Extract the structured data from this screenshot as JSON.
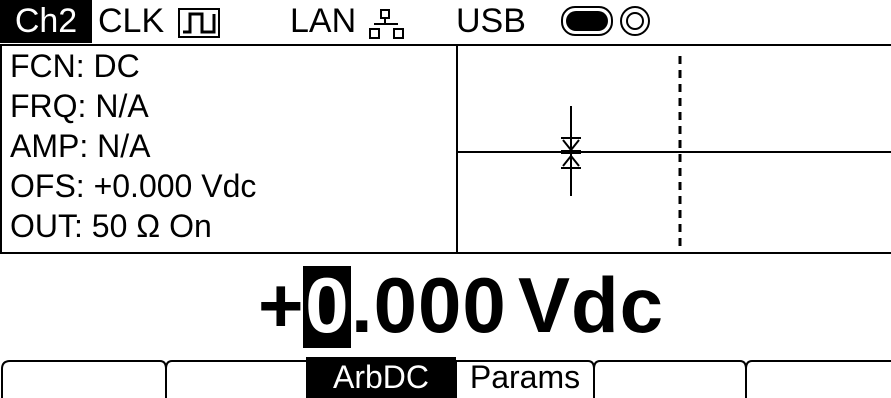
{
  "status_bar": {
    "channel": "Ch2",
    "clock_label": "CLK",
    "lan_label": "LAN",
    "usb_label": "USB"
  },
  "info_panel": {
    "function": "FCN: DC",
    "frequency": "FRQ: N/A",
    "amplitude": "AMP: N/A",
    "offset": "OFS: +0.000 Vdc",
    "output": "OUT: 50 Ω On"
  },
  "main_value": {
    "sign": "+",
    "cursor_digit": "0",
    "rest": ".000",
    "unit": "Vdc"
  },
  "softkeys": {
    "key1": "",
    "key2": "",
    "key3": "ArbDC",
    "key4": "Params",
    "key5": "",
    "key6": ""
  },
  "icons": {
    "clock": "square-wave-icon",
    "lan": "network-nodes-icon",
    "usb": "usb-drive-icon",
    "remote": "ring-icon"
  },
  "colors": {
    "foreground": "#000000",
    "background": "#ffffff"
  }
}
